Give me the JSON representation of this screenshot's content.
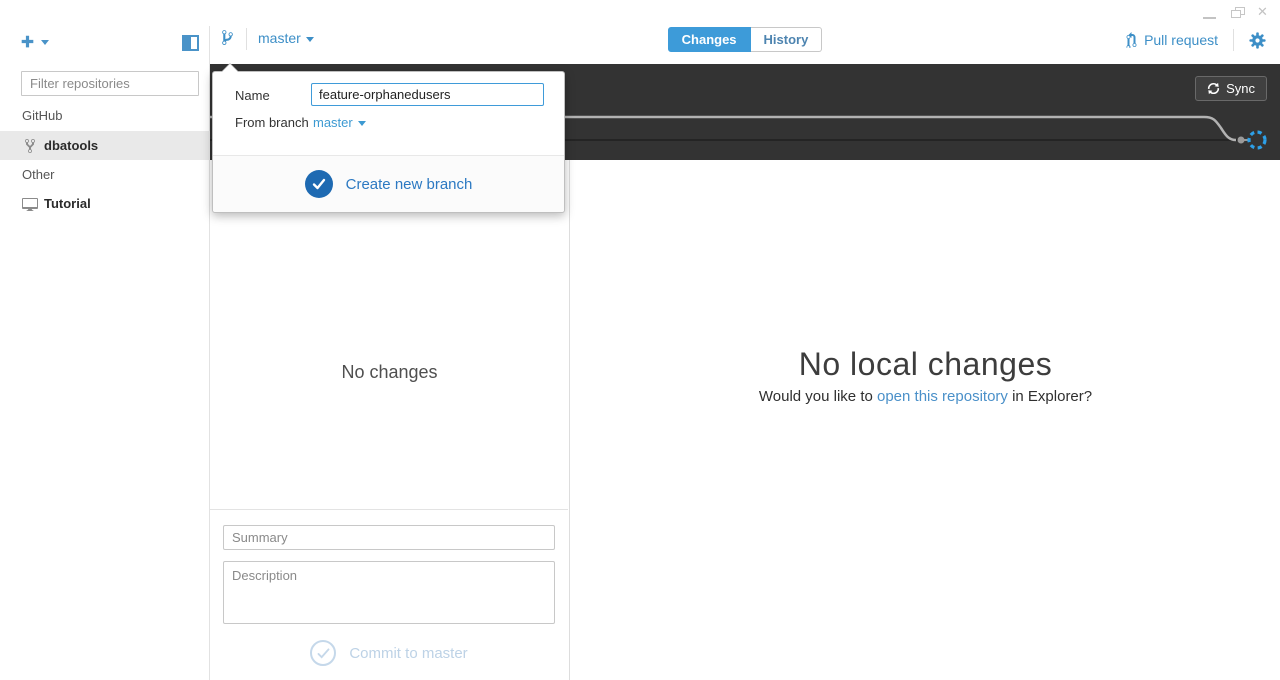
{
  "window": {
    "controls": {
      "minimize": "minimize",
      "restore": "restore",
      "close": "close"
    }
  },
  "sidebar": {
    "filter_placeholder": "Filter repositories",
    "groups": [
      {
        "label": "GitHub",
        "items": [
          {
            "label": "dbatools",
            "icon": "repo-forked-icon",
            "selected": true
          }
        ]
      },
      {
        "label": "Other",
        "items": [
          {
            "label": "Tutorial",
            "icon": "monitor-icon",
            "selected": false
          }
        ]
      }
    ]
  },
  "toolbar": {
    "branch_selector": "master",
    "tabs": [
      {
        "label": "Changes",
        "active": true
      },
      {
        "label": "History",
        "active": false
      }
    ],
    "pull_request_label": "Pull request"
  },
  "graph_bar": {
    "sync_label": "Sync"
  },
  "branch_popover": {
    "name_label": "Name",
    "name_value": "feature-orphanedusers",
    "from_branch_label": "From branch",
    "from_branch_value": "master",
    "create_label": "Create new branch"
  },
  "changes_panel": {
    "empty_text": "No changes",
    "summary_placeholder": "Summary",
    "description_placeholder": "Description",
    "commit_label": "Commit to master"
  },
  "main_panel": {
    "title": "No local changes",
    "subtitle_prefix": "Would you like to ",
    "subtitle_link": "open this repository",
    "subtitle_suffix": " in Explorer?"
  },
  "colors": {
    "accent_blue": "#3d8fc7",
    "tab_active_blue": "#3d9bd9",
    "create_button_blue": "#1e6ab2",
    "dark_bar": "#333333",
    "graph_line_light": "#b2b2b2",
    "graph_circle_blue": "#2da0e8",
    "disabled_commit": "#bdd2e6"
  }
}
